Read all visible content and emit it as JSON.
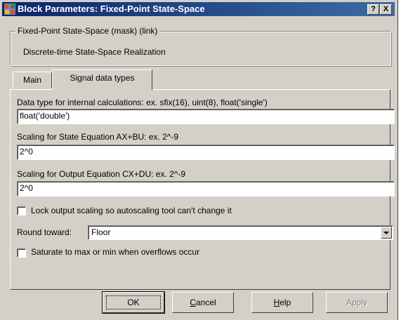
{
  "window": {
    "title": "Block Parameters: Fixed-Point State-Space",
    "help_button": "?",
    "close_button": "X"
  },
  "group": {
    "legend": "Fixed-Point State-Space (mask) (link)",
    "description": "Discrete-time State-Space Realization"
  },
  "tabs": [
    {
      "label": "Main",
      "active": false
    },
    {
      "label": "Signal data types",
      "active": true
    }
  ],
  "fields": {
    "internal": {
      "label": "Data type for internal calculations:    ex.  sfix(16),  uint(8),  float('single')",
      "value": "float('double')"
    },
    "state_scaling": {
      "label": "Scaling for State Equation AX+BU:   ex.  2^-9",
      "value": "2^0"
    },
    "output_scaling": {
      "label": "Scaling for Output Equation CX+DU:   ex.  2^-9",
      "value": "2^0"
    }
  },
  "lock_checkbox": {
    "label": "Lock output scaling so autoscaling tool can't change it",
    "checked": false
  },
  "round": {
    "label": "Round toward:",
    "value": "Floor"
  },
  "saturate_checkbox": {
    "label": "Saturate to max or min when overflows occur",
    "checked": false
  },
  "buttons": {
    "ok": "OK",
    "cancel_pre": "",
    "cancel_u": "C",
    "cancel_post": "ancel",
    "help_u": "H",
    "help_post": "elp",
    "apply": "Apply"
  },
  "colors": {
    "title_gradient_start": "#0a246a",
    "title_gradient_end": "#3a6ea5",
    "dialog_face": "#d4d0c8"
  }
}
